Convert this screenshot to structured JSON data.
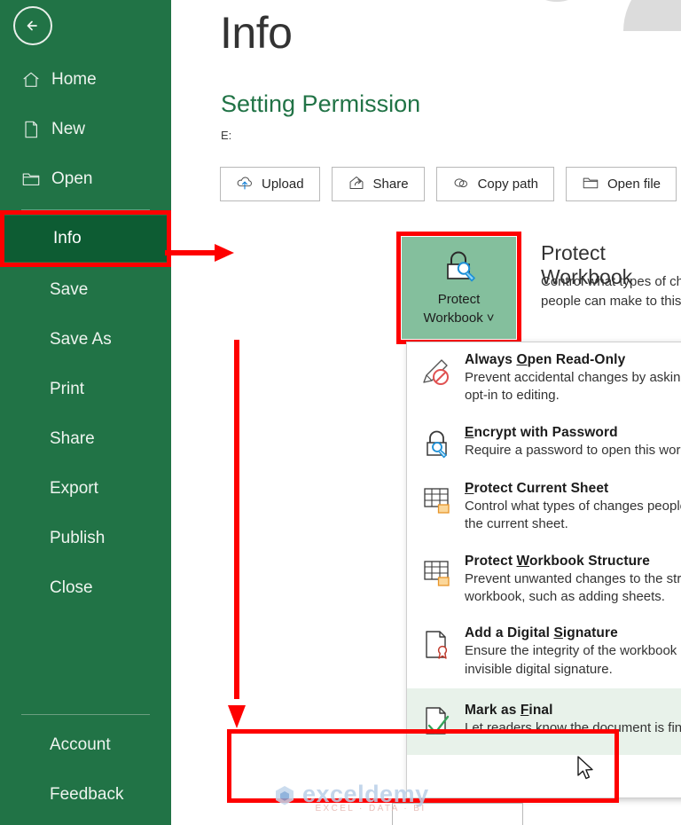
{
  "sidebar": {
    "back_icon": "back-arrow-circle-icon",
    "items": [
      {
        "label": "Home",
        "icon": "home-icon"
      },
      {
        "label": "New",
        "icon": "new-document-icon"
      },
      {
        "label": "Open",
        "icon": "open-folder-icon"
      }
    ],
    "selected_item": {
      "label": "Info",
      "icon": "info-icon"
    },
    "mid_items": [
      {
        "label": "Save"
      },
      {
        "label": "Save As"
      },
      {
        "label": "Print"
      },
      {
        "label": "Share"
      },
      {
        "label": "Export"
      },
      {
        "label": "Publish"
      },
      {
        "label": "Close"
      }
    ],
    "bottom_items": [
      {
        "label": "Account"
      },
      {
        "label": "Feedback"
      }
    ],
    "colors": {
      "background": "#217346",
      "selected_background": "#0d5c33",
      "text": "#eef4ef"
    }
  },
  "main": {
    "page_title": "Info",
    "document_title": "Setting Permission",
    "document_path": "E:",
    "buttons": [
      {
        "label": "Upload",
        "icon": "cloud-upload-icon"
      },
      {
        "label": "Share",
        "icon": "share-icon"
      },
      {
        "label": "Copy path",
        "icon": "link-icon"
      },
      {
        "label": "Open file",
        "icon": "folder-open-icon"
      }
    ],
    "protect": {
      "button_line1": "Protect",
      "button_line2": "Workbook",
      "button_caret": "˅",
      "icon": "lock-key-icon",
      "heading": "Protect Workbook",
      "description": "Control what types of changes people can make to this workbook.",
      "button_background": "#84bf9d"
    }
  },
  "dropdown": {
    "items": [
      {
        "icon": "pencil-no-entry-icon",
        "title_pre": "Always ",
        "title_accel": "O",
        "title_post": "pen Read-Only",
        "description": "Prevent accidental changes by asking readers to opt-in to editing.",
        "selected": false
      },
      {
        "icon": "lock-key-icon",
        "title_pre": "",
        "title_accel": "E",
        "title_post": "ncrypt with Password",
        "description": "Require a password to open this workbook.",
        "selected": false
      },
      {
        "icon": "sheet-lock-icon",
        "title_pre": "",
        "title_accel": "P",
        "title_post": "rotect Current Sheet",
        "description": "Control what types of changes people can make to the current sheet.",
        "selected": false
      },
      {
        "icon": "workbook-lock-icon",
        "title_pre": "Protect ",
        "title_accel": "W",
        "title_post": "orkbook Structure",
        "description": "Prevent unwanted changes to the structure of the workbook, such as adding sheets.",
        "selected": false
      },
      {
        "icon": "digital-signature-icon",
        "title_pre": "Add a Digital ",
        "title_accel": "S",
        "title_post": "ignature",
        "description": "Ensure the integrity of the workbook by adding an invisible digital signature.",
        "selected": false
      },
      {
        "icon": "mark-as-final-icon",
        "title_pre": "Mark as ",
        "title_accel": "F",
        "title_post": "inal",
        "description": "Let readers know the document is final.",
        "selected": true
      }
    ]
  },
  "annotations": {
    "highlight_color": "#fe0000",
    "arrow_from": "sidebar-item-info",
    "arrow_to": "protect-workbook-button",
    "vertical_arrow_to": "dropdown-item-mark-as-final"
  },
  "watermark": {
    "text": "exceldemy",
    "tagline": "EXCEL · DATA · BI"
  }
}
